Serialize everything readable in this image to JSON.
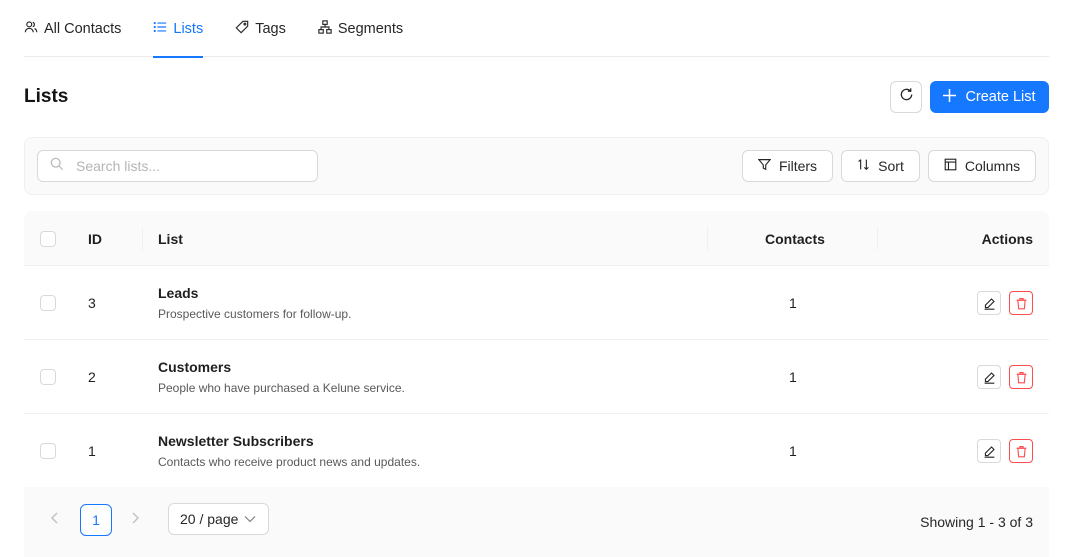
{
  "tabs": [
    {
      "label": "All Contacts",
      "icon": "contacts-icon",
      "active": false
    },
    {
      "label": "Lists",
      "icon": "list-icon",
      "active": true
    },
    {
      "label": "Tags",
      "icon": "tag-icon",
      "active": false
    },
    {
      "label": "Segments",
      "icon": "segments-icon",
      "active": false
    }
  ],
  "header": {
    "title": "Lists",
    "create_label": "Create List"
  },
  "toolbar": {
    "search_placeholder": "Search lists...",
    "filters_label": "Filters",
    "sort_label": "Sort",
    "columns_label": "Columns"
  },
  "table": {
    "columns": {
      "id": "ID",
      "list": "List",
      "contacts": "Contacts",
      "actions": "Actions"
    },
    "rows": [
      {
        "id": "3",
        "name": "Leads",
        "description": "Prospective customers for follow-up.",
        "contacts": "1"
      },
      {
        "id": "2",
        "name": "Customers",
        "description": "People who have purchased a Kelune service.",
        "contacts": "1"
      },
      {
        "id": "1",
        "name": "Newsletter Subscribers",
        "description": "Contacts who receive product news and updates.",
        "contacts": "1"
      }
    ]
  },
  "pagination": {
    "current_page": "1",
    "page_size": "20 / page",
    "showing": "Showing 1 - 3 of 3"
  },
  "colors": {
    "accent": "#1677ff",
    "danger": "#ff4d4f"
  }
}
